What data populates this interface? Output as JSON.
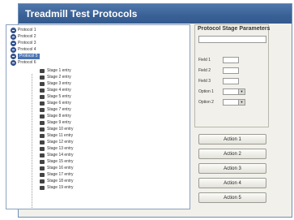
{
  "window": {
    "title": "Treadmill Test Protocols"
  },
  "tree": {
    "folders": [
      {
        "label": "Protocol 1",
        "selected": false
      },
      {
        "label": "Protocol 2",
        "selected": false
      },
      {
        "label": "Protocol 3",
        "selected": false
      },
      {
        "label": "Protocol 4",
        "selected": false
      },
      {
        "label": "Protocol 5",
        "selected": true
      },
      {
        "label": "Protocol 6",
        "selected": false
      }
    ],
    "stages": [
      "Stage 1 entry",
      "Stage 2 entry",
      "Stage 3 entry",
      "Stage 4 entry",
      "Stage 5 entry",
      "Stage 6 entry",
      "Stage 7 entry",
      "Stage 8 entry",
      "Stage 9 entry",
      "Stage 10 entry",
      "Stage 11 entry",
      "Stage 12 entry",
      "Stage 13 entry",
      "Stage 14 entry",
      "Stage 15 entry",
      "Stage 16 entry",
      "Stage 17 entry",
      "Stage 18 entry",
      "Stage 19 entry"
    ]
  },
  "params": {
    "group_title": "Protocol Stage Parameters",
    "fields": [
      {
        "label": "Field 1",
        "value": "",
        "unit": ""
      },
      {
        "label": "Field 2",
        "value": "",
        "unit": ""
      },
      {
        "label": "Field 3",
        "value": "",
        "unit": ""
      }
    ],
    "selects": [
      {
        "label": "Option 1",
        "value": ""
      },
      {
        "label": "Option 2",
        "value": ""
      }
    ]
  },
  "buttons": {
    "b1": "Action 1",
    "b2": "Action 2",
    "b3": "Action 3",
    "b4": "Action 4",
    "b5": "Action 5"
  },
  "colors": {
    "title_bar": "#3a6196",
    "selection": "#4a72b0",
    "expander": "#3b5fa0"
  }
}
